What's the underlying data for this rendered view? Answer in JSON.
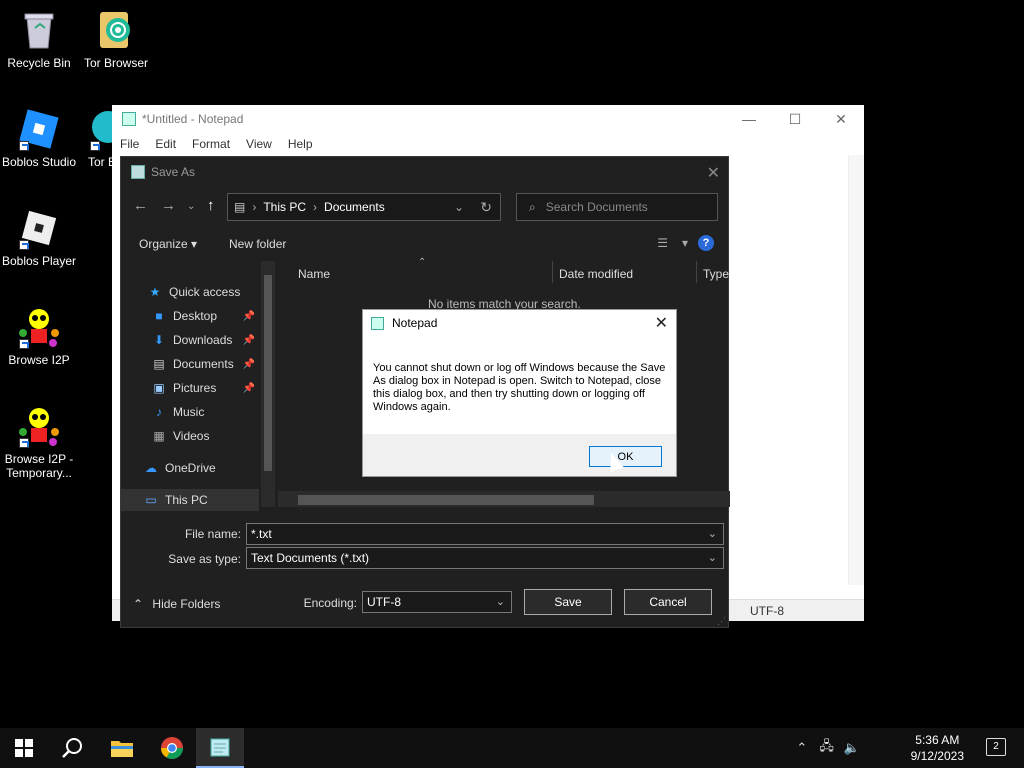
{
  "desktop": {
    "icons": [
      {
        "label": "Recycle Bin"
      },
      {
        "label": "Tor Browser"
      },
      {
        "label": "Boblos Studio"
      },
      {
        "label": "Tor B"
      },
      {
        "label": "Boblos Player"
      },
      {
        "label": "Browse I2P"
      },
      {
        "label": "Browse I2P - Temporary..."
      }
    ]
  },
  "notepad": {
    "title": "*Untitled - Notepad",
    "menu": [
      "File",
      "Edit",
      "Format",
      "View",
      "Help"
    ],
    "status_encoding": "UTF-8"
  },
  "save_as": {
    "title": "Save As",
    "breadcrumb": [
      "This PC",
      "Documents"
    ],
    "search_placeholder": "Search Documents",
    "organize_label": "Organize",
    "new_folder_label": "New folder",
    "nav_items": [
      {
        "label": "Quick access"
      },
      {
        "label": "Desktop"
      },
      {
        "label": "Downloads"
      },
      {
        "label": "Documents"
      },
      {
        "label": "Pictures"
      },
      {
        "label": "Music"
      },
      {
        "label": "Videos"
      },
      {
        "label": "OneDrive"
      },
      {
        "label": "This PC"
      }
    ],
    "columns": [
      "Name",
      "Date modified",
      "Type"
    ],
    "empty_message": "No items match your search.",
    "file_name_label": "File name:",
    "file_name_value": "*.txt",
    "save_type_label": "Save as type:",
    "save_type_value": "Text Documents (*.txt)",
    "hide_folders_label": "Hide Folders",
    "encoding_label": "Encoding:",
    "encoding_value": "UTF-8",
    "save_button": "Save",
    "cancel_button": "Cancel"
  },
  "alert": {
    "title": "Notepad",
    "message": "You cannot shut down or log off Windows because the Save As dialog box in Notepad is open. Switch to Notepad, close this dialog box, and then try shutting down or logging off Windows again.",
    "ok_button": "OK"
  },
  "taskbar": {
    "time": "5:36 AM",
    "date": "9/12/2023",
    "notification_count": "2"
  },
  "colors": {
    "accent": "#0078d7",
    "dialog_bg": "#202020",
    "taskbar_bg": "#101010"
  }
}
